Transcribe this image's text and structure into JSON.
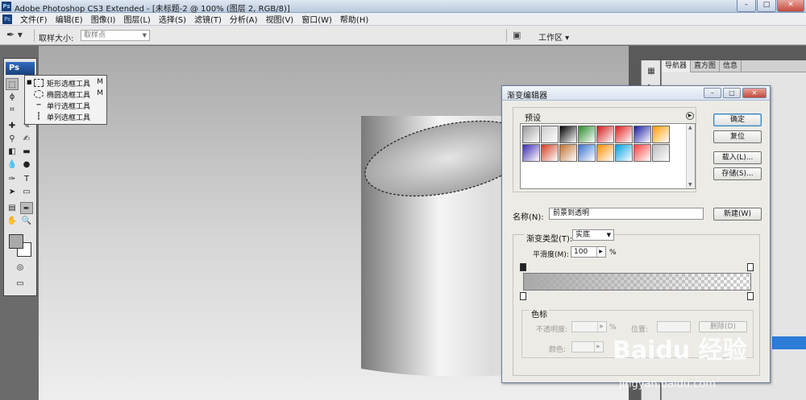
{
  "window": {
    "title": "Adobe Photoshop CS3 Extended - [未标题-2 @ 100% (图层 2, RGB/8)]",
    "app_icon": "Ps"
  },
  "menu": [
    {
      "label": "文件(F)"
    },
    {
      "label": "编辑(E)"
    },
    {
      "label": "图像(I)"
    },
    {
      "label": "图层(L)"
    },
    {
      "label": "选择(S)"
    },
    {
      "label": "滤镜(T)"
    },
    {
      "label": "分析(A)"
    },
    {
      "label": "视图(V)"
    },
    {
      "label": "窗口(W)"
    },
    {
      "label": "帮助(H)"
    }
  ],
  "options": {
    "sample_size_label": "取样大小:",
    "sample_size_value": "取样点",
    "workspace_label": "工作区 ▾"
  },
  "tools": {
    "logo": "Ps"
  },
  "flyout": {
    "items": [
      {
        "label": "矩形选框工具",
        "key": "M",
        "active": true,
        "icon": "rect-marquee-icon"
      },
      {
        "label": "椭圆选框工具",
        "key": "M",
        "active": false,
        "icon": "ellipse-marquee-icon"
      },
      {
        "label": "单行选框工具",
        "key": "",
        "active": false,
        "icon": "single-row-icon"
      },
      {
        "label": "单列选框工具",
        "key": "",
        "active": false,
        "icon": "single-col-icon"
      }
    ]
  },
  "right_panel": {
    "tabs": [
      {
        "label": "导航器"
      },
      {
        "label": "直方图"
      },
      {
        "label": "信息"
      }
    ]
  },
  "dialog": {
    "title": "渐变编辑器",
    "presets_label": "预设",
    "buttons": {
      "ok": "确定",
      "reset": "复位",
      "load": "载入(L)...",
      "save": "存储(S)...",
      "new": "新建(W)"
    },
    "name_label": "名称(N):",
    "name_value": "前景到透明",
    "gradient_type_label": "渐变类型(T):",
    "gradient_type_value": "实底",
    "smoothness_label": "平滑度(M):",
    "smoothness_value": "100",
    "smoothness_unit": "%",
    "stops": {
      "group_label": "色标",
      "opacity_label": "不透明度:",
      "opacity_unit": "%",
      "location_label": "位置:",
      "delete_label": "删除(D)",
      "color_label": "颜色:"
    },
    "preset_colors": [
      [
        "#9a9a9a",
        "#cccccc",
        "#000000",
        "#2a8a2a",
        "#d21a1a",
        "#e02020",
        "#1a1aa0",
        "#ff9c00"
      ],
      [
        "#3a2bb0",
        "#d04020",
        "#c07030",
        "#3a70d0",
        "#ff8c00",
        "#00a0e0",
        "#ff4040",
        "#bdbdbd"
      ]
    ]
  },
  "watermark": {
    "text": "Baidu 经验",
    "url": "jingyan.baidu.com"
  }
}
